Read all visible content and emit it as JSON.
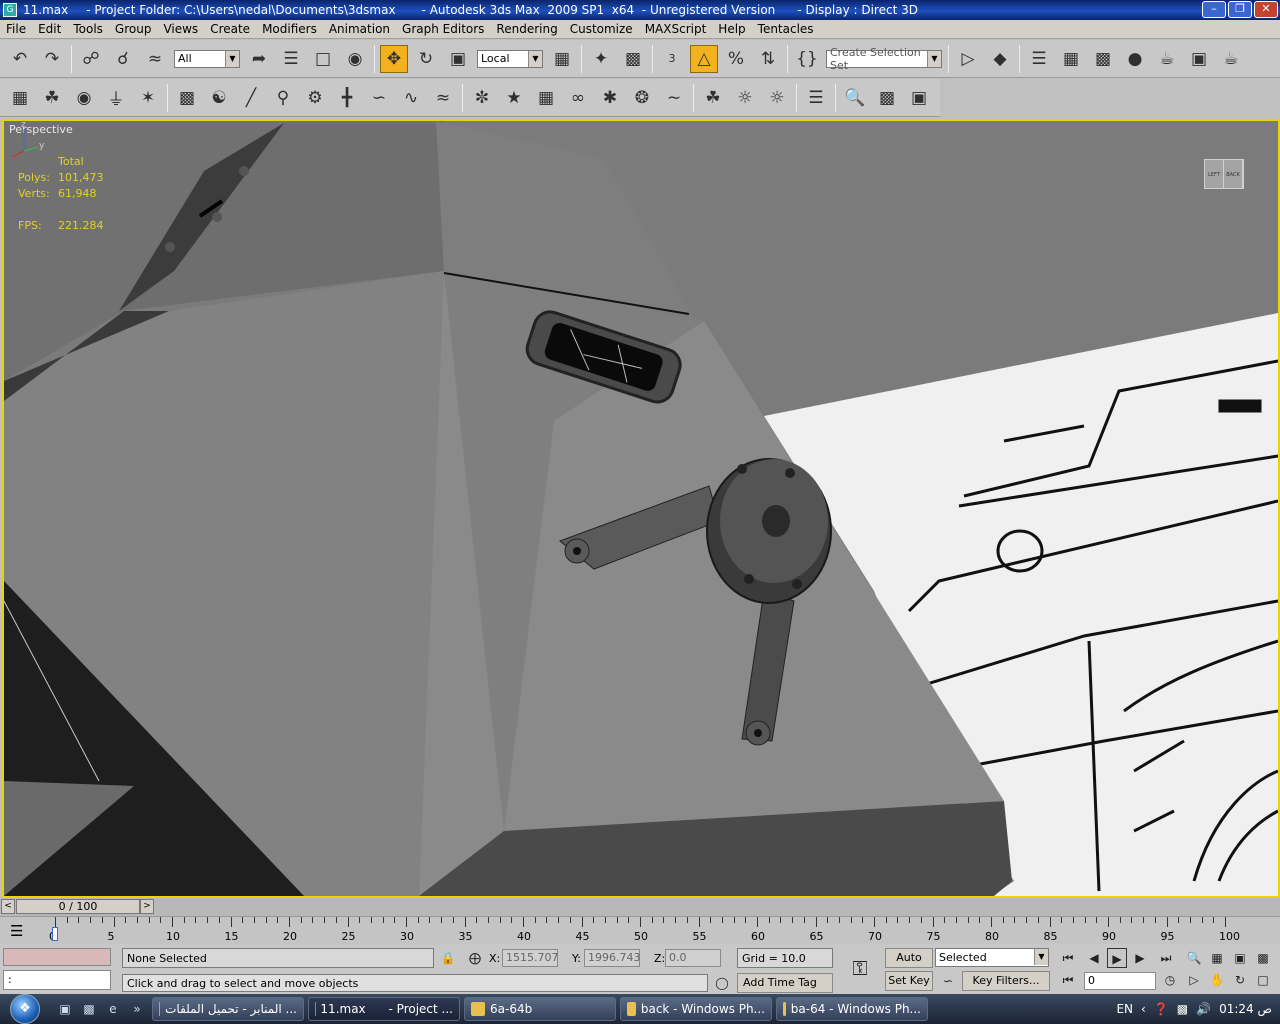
{
  "title": {
    "file": "11.max",
    "project": "- Project Folder: C:\\Users\\nedal\\Documents\\3dsmax",
    "app": "- Autodesk 3ds Max  2009 SP1  x64  - Unregistered Version",
    "display": "- Display : Direct 3D"
  },
  "menu": [
    "File",
    "Edit",
    "Tools",
    "Group",
    "Views",
    "Create",
    "Modifiers",
    "Animation",
    "Graph Editors",
    "Rendering",
    "Customize",
    "MAXScript",
    "Help",
    "Tentacles"
  ],
  "toolbar": {
    "filter": "All",
    "coord": "Local",
    "selection_set": "Create Selection Set",
    "snap_label": "3"
  },
  "viewport": {
    "label": "Perspective",
    "stats": {
      "header": "Total",
      "polys_label": "Polys:",
      "polys": "101,473",
      "verts_label": "Verts:",
      "verts": "61,948",
      "fps_label": "FPS:",
      "fps": "221.284"
    },
    "viewcube_left": "LEFT",
    "viewcube_right": "BACK",
    "axis_z": "z",
    "axis_y": "y"
  },
  "time": {
    "slider": "0 / 100",
    "ticks": [
      "0",
      "5",
      "10",
      "15",
      "20",
      "25",
      "30",
      "35",
      "40",
      "45",
      "50",
      "55",
      "60",
      "65",
      "70",
      "75",
      "80",
      "85",
      "90",
      "95",
      "100"
    ]
  },
  "status": {
    "selection": "None Selected",
    "prompt": "Click and drag to select and move objects",
    "cmd": ":",
    "x_label": "X:",
    "x": "1515.707",
    "y_label": "Y:",
    "y": "1996.743",
    "z_label": "Z:",
    "z": "0.0",
    "grid": "Grid = 10.0",
    "add_time_tag": "Add Time Tag",
    "auto_key": "Auto Key",
    "set_key": "Set Key",
    "key_mode": "Selected",
    "key_filters": "Key Filters...",
    "frame": "0"
  },
  "taskbar": {
    "tasks": [
      "المنابر - تحميل الملفات ...",
      "11.max      - Project ...",
      "6a-64b",
      "back - Windows Ph...",
      "ba-64 - Windows Ph..."
    ],
    "lang": "EN",
    "time": "01:24 ص"
  },
  "colors": {
    "viewport_border": "#e6d700",
    "stats_text": "#e2d02a",
    "active_tool": "#f3b21d"
  }
}
